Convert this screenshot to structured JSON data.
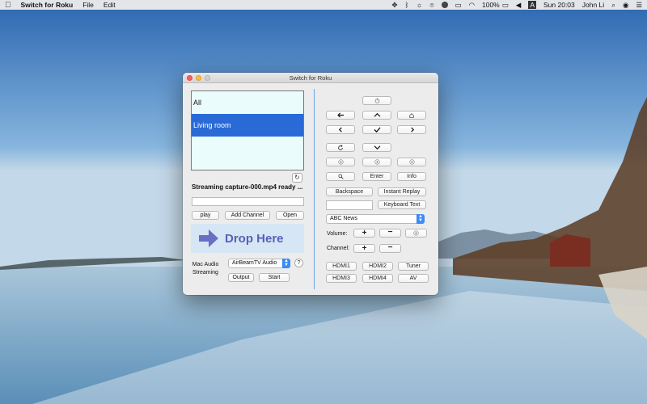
{
  "menubar": {
    "app_name": "Switch for Roku",
    "menus": [
      "File",
      "Edit"
    ],
    "battery": "100%",
    "clock": "Sun 20:03",
    "user": "John Li",
    "input_source": "A"
  },
  "window": {
    "title": "Switch for Roku"
  },
  "devices": [
    {
      "label": "All",
      "selected": false
    },
    {
      "label": "Living room",
      "selected": true
    }
  ],
  "status_text": "Streaming capture-000.mp4 ready ...",
  "media": {
    "url_value": "",
    "play_label": "play",
    "add_channel_label": "Add Channel",
    "open_label": "Open",
    "drop_label": "Drop Here"
  },
  "audio": {
    "label_line1": "Mac Audio",
    "label_line2": "Streaming",
    "device_selected": "AirBeamTV Audio",
    "help_label": "?",
    "output_label": "Output",
    "start_label": "Start"
  },
  "remote": {
    "enter_label": "Enter",
    "info_label": "Info",
    "backspace_label": "Backspace",
    "instant_replay_label": "Instant Replay",
    "keyboard_text_value": "",
    "keyboard_text_label": "Keyboard Text",
    "channel_selected": "ABC News",
    "volume_label": "Volume:",
    "channel_label": "Channel:",
    "plus": "+",
    "minus": "−",
    "inputs": [
      "HDMI1",
      "HDMI2",
      "Tuner",
      "HDMI3",
      "HDMI4",
      "AV"
    ]
  },
  "colors": {
    "selection": "#2a6ad6",
    "list_background": "#eafdfc",
    "drop_text": "#5a5fb8",
    "divider": "#6aa2e8"
  }
}
